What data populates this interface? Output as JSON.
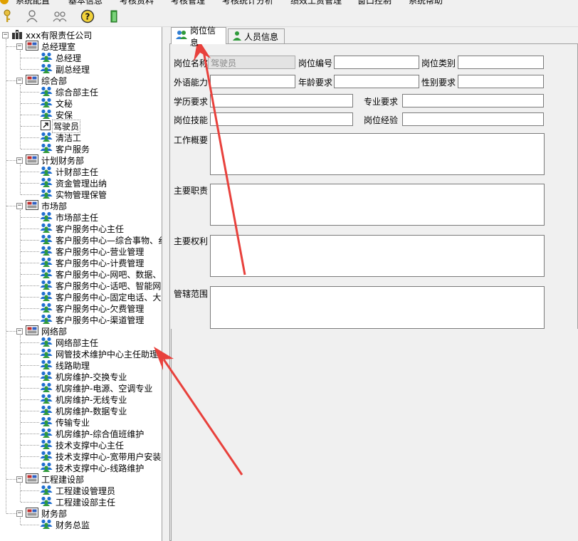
{
  "menu": [
    "系统配置",
    "基本信息",
    "考核资料",
    "考核管理",
    "考核统计分析",
    "绩效工资管理",
    "窗口控制",
    "系统帮助"
  ],
  "toolbar": {
    "items": [
      {
        "name": "key-icon"
      },
      {
        "name": "user-settings-icon"
      },
      {
        "name": "group-icon"
      },
      {
        "name": "help-icon"
      },
      {
        "name": "exit-icon"
      }
    ]
  },
  "tree": {
    "root": "xxx有限责任公司",
    "nodes": [
      {
        "label": "总经理室",
        "level": 1,
        "type": "dept"
      },
      {
        "label": "总经理",
        "level": 2,
        "type": "post"
      },
      {
        "label": "副总经理",
        "level": 2,
        "type": "post"
      },
      {
        "label": "综合部",
        "level": 1,
        "type": "dept"
      },
      {
        "label": "综合部主任",
        "level": 2,
        "type": "post"
      },
      {
        "label": "文秘",
        "level": 2,
        "type": "post"
      },
      {
        "label": "安保",
        "level": 2,
        "type": "post"
      },
      {
        "label": "驾驶员",
        "level": 2,
        "type": "post-selected"
      },
      {
        "label": "清洁工",
        "level": 2,
        "type": "post"
      },
      {
        "label": "客户服务",
        "level": 2,
        "type": "post"
      },
      {
        "label": "计划财务部",
        "level": 1,
        "type": "dept"
      },
      {
        "label": "计财部主任",
        "level": 2,
        "type": "post"
      },
      {
        "label": "资金管理出纳",
        "level": 2,
        "type": "post"
      },
      {
        "label": "实物管理保管",
        "level": 2,
        "type": "post"
      },
      {
        "label": "市场部",
        "level": 1,
        "type": "dept"
      },
      {
        "label": "市场部主任",
        "level": 2,
        "type": "post"
      },
      {
        "label": "客户服务中心主任",
        "level": 2,
        "type": "post"
      },
      {
        "label": "客户服务中心—综合事物、纟",
        "level": 2,
        "type": "post"
      },
      {
        "label": "客户服务中心-营业管理",
        "level": 2,
        "type": "post"
      },
      {
        "label": "客户服务中心-计费管理",
        "level": 2,
        "type": "post"
      },
      {
        "label": "客户服务中心-网吧、数据、",
        "level": 2,
        "type": "post"
      },
      {
        "label": "客户服务中心-话吧、智能网",
        "level": 2,
        "type": "post"
      },
      {
        "label": "客户服务中心-固定电话、大",
        "level": 2,
        "type": "post"
      },
      {
        "label": "客户服务中心-欠费管理",
        "level": 2,
        "type": "post"
      },
      {
        "label": "客户服务中心-渠道管理",
        "level": 2,
        "type": "post"
      },
      {
        "label": "网络部",
        "level": 1,
        "type": "dept"
      },
      {
        "label": "网络部主任",
        "level": 2,
        "type": "post"
      },
      {
        "label": "网管技术维护中心主任助理",
        "level": 2,
        "type": "post"
      },
      {
        "label": "线路助理",
        "level": 2,
        "type": "post"
      },
      {
        "label": "机房维护-交换专业",
        "level": 2,
        "type": "post"
      },
      {
        "label": "机房维护-电源、空调专业",
        "level": 2,
        "type": "post"
      },
      {
        "label": "机房维护-无线专业",
        "level": 2,
        "type": "post"
      },
      {
        "label": "机房维护-数据专业",
        "level": 2,
        "type": "post"
      },
      {
        "label": "传输专业",
        "level": 2,
        "type": "post"
      },
      {
        "label": "机房维护-综合值班维护",
        "level": 2,
        "type": "post"
      },
      {
        "label": "技术支撑中心主任",
        "level": 2,
        "type": "post"
      },
      {
        "label": "技术支撑中心-宽带用户安装",
        "level": 2,
        "type": "post"
      },
      {
        "label": "技术支撑中心-线路维护",
        "level": 2,
        "type": "post"
      },
      {
        "label": "工程建设部",
        "level": 1,
        "type": "dept"
      },
      {
        "label": "工程建设管理员",
        "level": 2,
        "type": "post"
      },
      {
        "label": "工程建设部主任",
        "level": 2,
        "type": "post"
      },
      {
        "label": "财务部",
        "level": 1,
        "type": "dept"
      },
      {
        "label": "财务总监",
        "level": 2,
        "type": "post"
      }
    ]
  },
  "tabs": [
    {
      "label": "岗位信息",
      "active": true
    },
    {
      "label": "人员信息",
      "active": false
    }
  ],
  "form": {
    "post_name_label": "岗位名称",
    "post_name_value": "驾驶员",
    "post_code_label": "岗位编号",
    "post_code_value": "",
    "post_category_label": "岗位类别",
    "post_category_value": "",
    "foreign_lang_label": "外语能力",
    "foreign_lang_value": "",
    "age_req_label": "年龄要求",
    "age_req_value": "",
    "gender_req_label": "性别要求",
    "gender_req_value": "",
    "education_label": "学历要求",
    "education_value": "",
    "major_label": "专业要求",
    "major_value": "",
    "skills_label": "岗位技能",
    "skills_value": "",
    "experience_label": "岗位经验",
    "experience_value": "",
    "overview_label": "工作概要",
    "duties_label": "主要职责",
    "rights_label": "主要权利",
    "scope_label": "管辖范围"
  },
  "colors": {
    "annotation_arrow": "#e8413c",
    "disabled_input": "#e3e3e3"
  }
}
